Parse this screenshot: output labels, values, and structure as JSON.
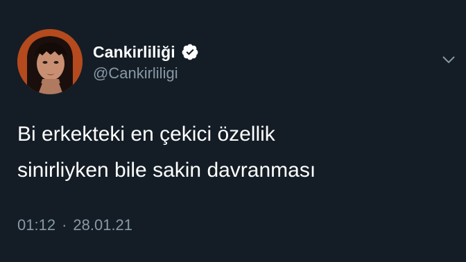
{
  "colors": {
    "background": "#141d26",
    "text_primary": "#ffffff",
    "text_secondary": "#8899a6",
    "verified_badge": "#ffffff",
    "avatar_background": "#b44a1d"
  },
  "author": {
    "display_name": "Cankirliliği",
    "handle": "@Cankirliligi",
    "verified": true,
    "verified_icon": "verified-badge-icon",
    "avatar_icon": "profile-avatar"
  },
  "menu": {
    "icon": "chevron-down-icon"
  },
  "tweet": {
    "lines": [
      "Bi erkekteki en çekici özellik",
      "sinirliyken bile sakin davranması"
    ]
  },
  "meta": {
    "time": "01:12",
    "separator": "·",
    "date": "28.01.21"
  }
}
